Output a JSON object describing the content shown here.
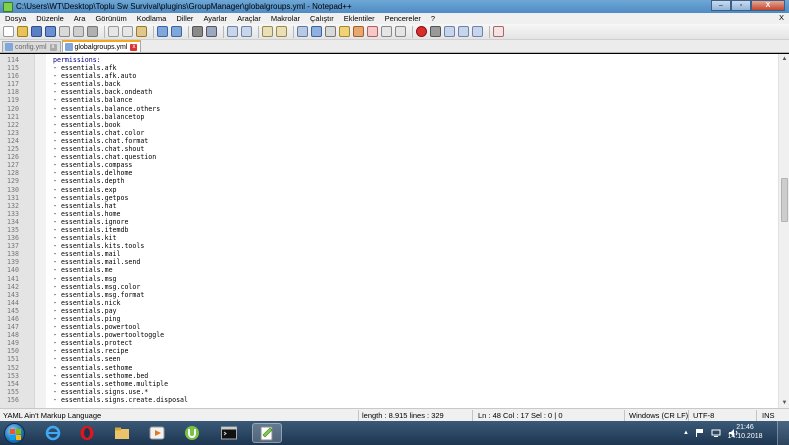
{
  "window": {
    "title": "C:\\Users\\WT\\Desktop\\Toplu Sw Survival\\plugins\\GroupManager\\globalgroups.yml - Notepad++",
    "minimize": "–",
    "maximize": "▫",
    "close": "X"
  },
  "menu": {
    "items": [
      "Dosya",
      "Düzenle",
      "Ara",
      "Görünüm",
      "Kodlama",
      "Diller",
      "Ayarlar",
      "Araçlar",
      "Makrolar",
      "Çalıştır",
      "Eklentiler",
      "Pencereler",
      "?"
    ],
    "close_doc": "X"
  },
  "tabs": [
    {
      "label": "config.yml",
      "active": false
    },
    {
      "label": "globalgroups.yml",
      "active": true
    }
  ],
  "tab_close": "x",
  "editor": {
    "lines": [
      {
        "n": "114",
        "text": "permissions:"
      },
      {
        "n": "115",
        "text": "- essentials.afk"
      },
      {
        "n": "116",
        "text": "- essentials.afk.auto"
      },
      {
        "n": "117",
        "text": "- essentials.back"
      },
      {
        "n": "118",
        "text": "- essentials.back.ondeath"
      },
      {
        "n": "119",
        "text": "- essentials.balance"
      },
      {
        "n": "120",
        "text": "- essentials.balance.others"
      },
      {
        "n": "121",
        "text": "- essentials.balancetop"
      },
      {
        "n": "122",
        "text": "- essentials.book"
      },
      {
        "n": "123",
        "text": "- essentials.chat.color"
      },
      {
        "n": "124",
        "text": "- essentials.chat.format"
      },
      {
        "n": "125",
        "text": "- essentials.chat.shout"
      },
      {
        "n": "126",
        "text": "- essentials.chat.question"
      },
      {
        "n": "127",
        "text": "- essentials.compass"
      },
      {
        "n": "128",
        "text": "- essentials.delhome"
      },
      {
        "n": "129",
        "text": "- essentials.depth"
      },
      {
        "n": "130",
        "text": "- essentials.exp"
      },
      {
        "n": "131",
        "text": "- essentials.getpos"
      },
      {
        "n": "132",
        "text": "- essentials.hat"
      },
      {
        "n": "133",
        "text": "- essentials.home"
      },
      {
        "n": "134",
        "text": "- essentials.ignore"
      },
      {
        "n": "135",
        "text": "- essentials.itemdb"
      },
      {
        "n": "136",
        "text": "- essentials.kit"
      },
      {
        "n": "137",
        "text": "- essentials.kits.tools"
      },
      {
        "n": "138",
        "text": "- essentials.mail"
      },
      {
        "n": "139",
        "text": "- essentials.mail.send"
      },
      {
        "n": "140",
        "text": "- essentials.me"
      },
      {
        "n": "141",
        "text": "- essentials.msg"
      },
      {
        "n": "142",
        "text": "- essentials.msg.color"
      },
      {
        "n": "143",
        "text": "- essentials.msg.format"
      },
      {
        "n": "144",
        "text": "- essentials.nick"
      },
      {
        "n": "145",
        "text": "- essentials.pay"
      },
      {
        "n": "146",
        "text": "- essentials.ping"
      },
      {
        "n": "147",
        "text": "- essentials.powertool"
      },
      {
        "n": "148",
        "text": "- essentials.powertooltoggle"
      },
      {
        "n": "149",
        "text": "- essentials.protect"
      },
      {
        "n": "150",
        "text": "- essentials.recipe"
      },
      {
        "n": "151",
        "text": "- essentials.seen"
      },
      {
        "n": "152",
        "text": "- essentials.sethome"
      },
      {
        "n": "153",
        "text": "- essentials.sethome.bed"
      },
      {
        "n": "154",
        "text": "- essentials.sethome.multiple"
      },
      {
        "n": "155",
        "text": "- essentials.signs.use.*"
      },
      {
        "n": "156",
        "text": "- essentials.signs.create.disposal"
      }
    ]
  },
  "status": {
    "language": "YAML Ain't Markup Language",
    "length_lines": "length : 8.915    lines : 329",
    "position": "Ln : 48    Col : 17    Sel : 0 | 0",
    "eol": "Windows (CR LF)",
    "encoding": "UTF-8",
    "mode": "INS"
  },
  "taskbar": {
    "clock_time": "21:46",
    "clock_date": "14.10.2018",
    "tray_arrow": "▲"
  },
  "colors": {
    "accent_tab": "#f5a623",
    "keyword": "#000080"
  }
}
